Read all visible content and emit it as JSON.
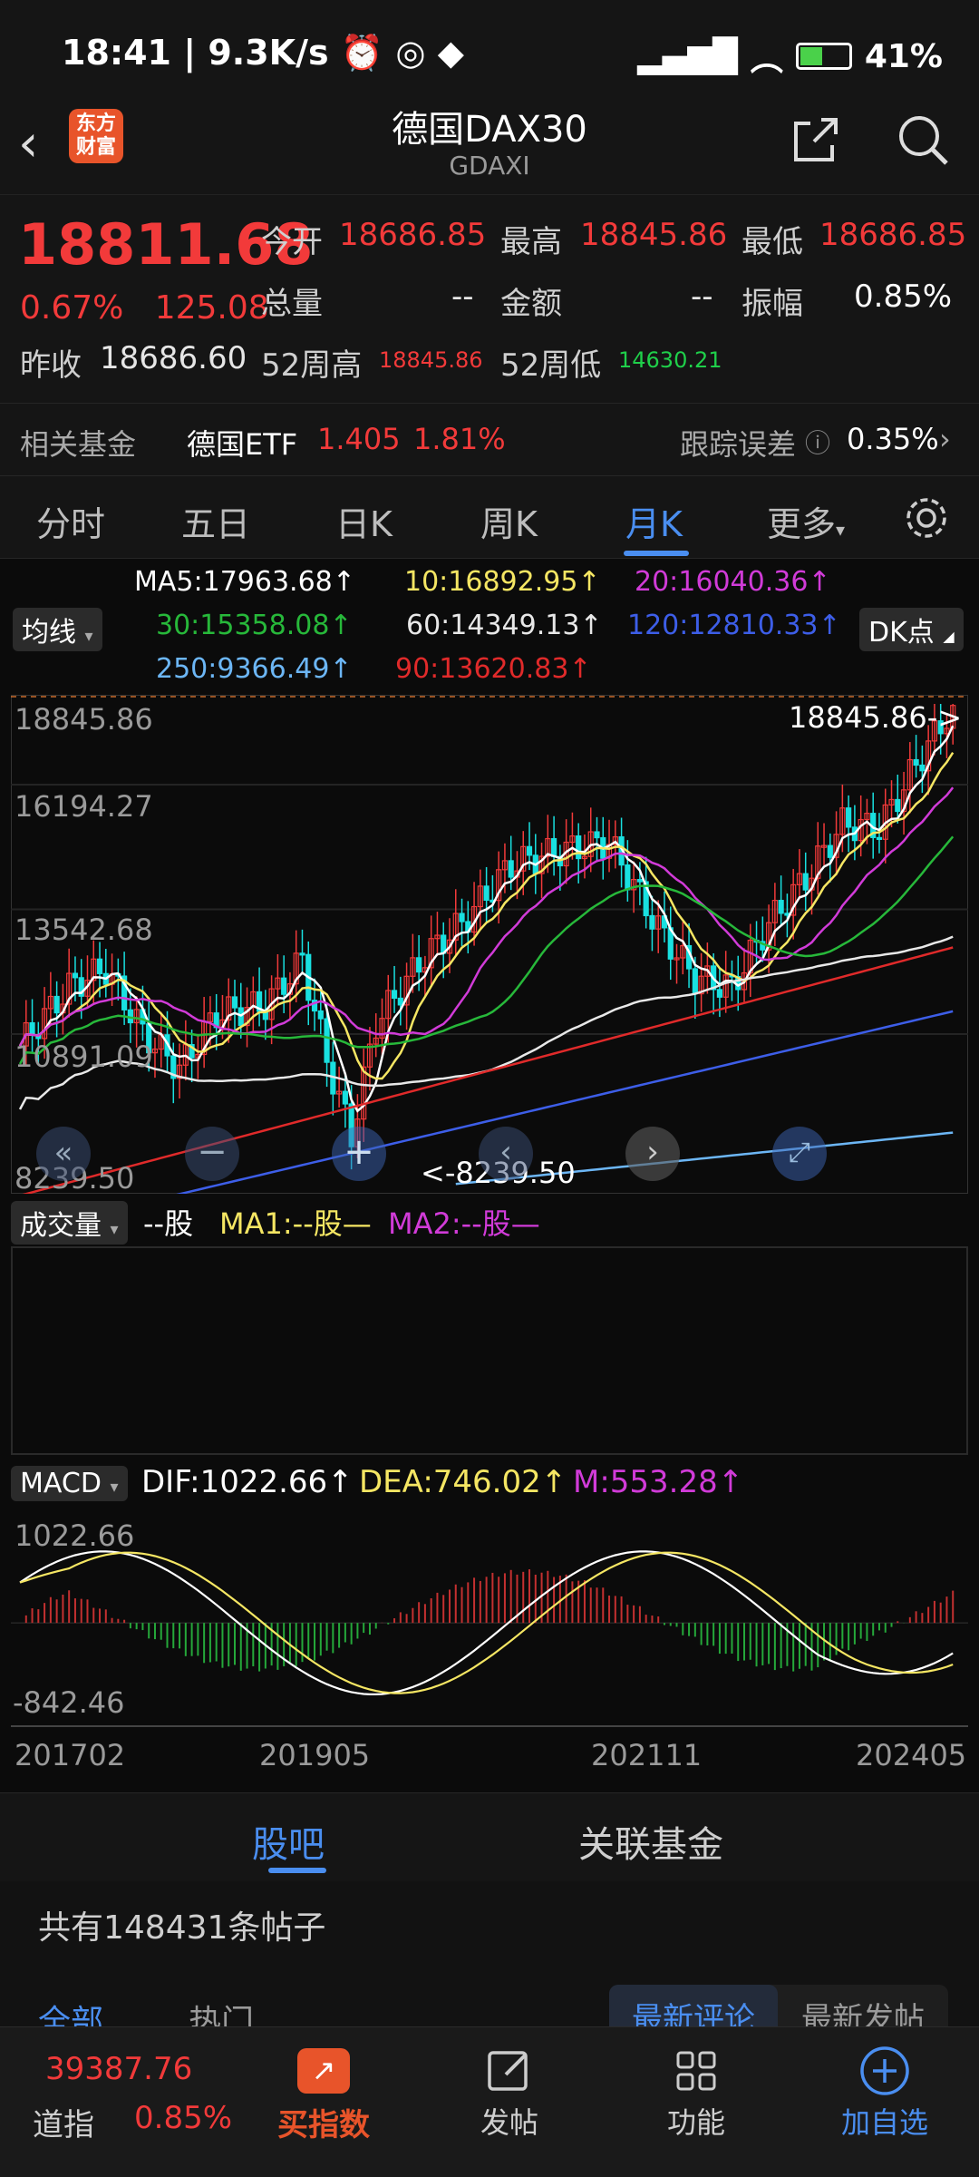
{
  "status_bar": {
    "time": "18:41",
    "speed": "9.3K/s",
    "battery": "41%"
  },
  "nav": {
    "logo_text_1": "东方",
    "logo_text_2": "财富",
    "title": "德国DAX30",
    "subtitle": "GDAXI"
  },
  "quote": {
    "price": "18811.68",
    "change_pct": "0.67%",
    "change": "125.08",
    "open_label": "今开",
    "open": "18686.85",
    "high_label": "最高",
    "high": "18845.86",
    "low_label": "最低",
    "low": "18686.85",
    "volume_label": "总量",
    "volume": "--",
    "amount_label": "金额",
    "amount": "--",
    "amplitude_label": "振幅",
    "amplitude": "0.85%",
    "prev_close_label": "昨收",
    "prev_close": "18686.60",
    "w52_high_label": "52周高",
    "w52_high": "18845.86",
    "w52_low_label": "52周低",
    "w52_low": "14630.21"
  },
  "fund": {
    "label": "相关基金",
    "name": "德国ETF",
    "price": "1.405",
    "pct": "1.81%",
    "track_label": "跟踪误差",
    "track_value": "0.35%"
  },
  "tabs": [
    "分时",
    "五日",
    "日K",
    "周K",
    "月K",
    "更多"
  ],
  "ma_legend": {
    "ma_type": "均线",
    "dk": "DK点",
    "ma5": "MA5:17963.68↑",
    "ma10": "10:16892.95↑",
    "ma20": "20:16040.36↑",
    "ma30": "30:15358.08↑",
    "ma60": "60:14349.13↑",
    "ma120": "120:12810.33↑",
    "ma250": "250:9366.49↑",
    "ma90": "90:13620.83↑"
  },
  "price_axis": [
    "18845.86",
    "16194.27",
    "13542.68",
    "10891.09",
    "8239.50"
  ],
  "high_marker": "18845.86->",
  "low_marker": "<-8239.50",
  "volume_legend": {
    "label": "成交量",
    "value": "--股",
    "ma1": "MA1:--股—",
    "ma2": "MA2:--股—"
  },
  "macd_legend": {
    "label": "MACD",
    "dif": "DIF:1022.66↑",
    "dea": "DEA:746.02↑",
    "m": "M:553.28↑"
  },
  "macd_axis": [
    "1022.66",
    "-842.46"
  ],
  "time_axis": [
    "201702",
    "201905",
    "202111",
    "202405"
  ],
  "subtabs": [
    "股吧",
    "关联基金"
  ],
  "posts": {
    "count_text": "共有148431条帖子",
    "filter_all": "全部",
    "filter_hot": "热门",
    "sort_latest_comment": "最新评论",
    "sort_latest_post": "最新发帖"
  },
  "bottom": {
    "ticker_price": "39387.76",
    "ticker_name": "道指",
    "ticker_pct": "0.85%",
    "buy_index": "买指数",
    "post": "发帖",
    "function": "功能",
    "add_watch": "加自选"
  },
  "colors": {
    "up": "#f23a3a",
    "down": "#1fcf4a",
    "accent": "#4a8ef0",
    "ma5": "#ffffff",
    "ma10": "#f5e663",
    "ma20": "#d13bd8",
    "ma30": "#27b83a",
    "ma60": "#e8e8e8",
    "ma120": "#3d5ee8",
    "ma250": "#6cb6f5",
    "ma90": "#e02a2a"
  },
  "chart_data": {
    "type": "candlestick",
    "period": "monthly",
    "y_range": [
      8239.5,
      18845.86
    ],
    "x_labels": [
      "201702",
      "201905",
      "202111",
      "202405"
    ],
    "moving_averages": {
      "MA5": 17963.68,
      "MA10": 16892.95,
      "MA20": 16040.36,
      "MA30": 15358.08,
      "MA60": 14349.13,
      "MA120": 12810.33,
      "MA250": 9366.49,
      "MA90": 13620.83
    },
    "macd": {
      "DIF": 1022.66,
      "DEA": 746.02,
      "M": 553.28,
      "y_range": [
        -842.46,
        1022.66
      ]
    }
  }
}
